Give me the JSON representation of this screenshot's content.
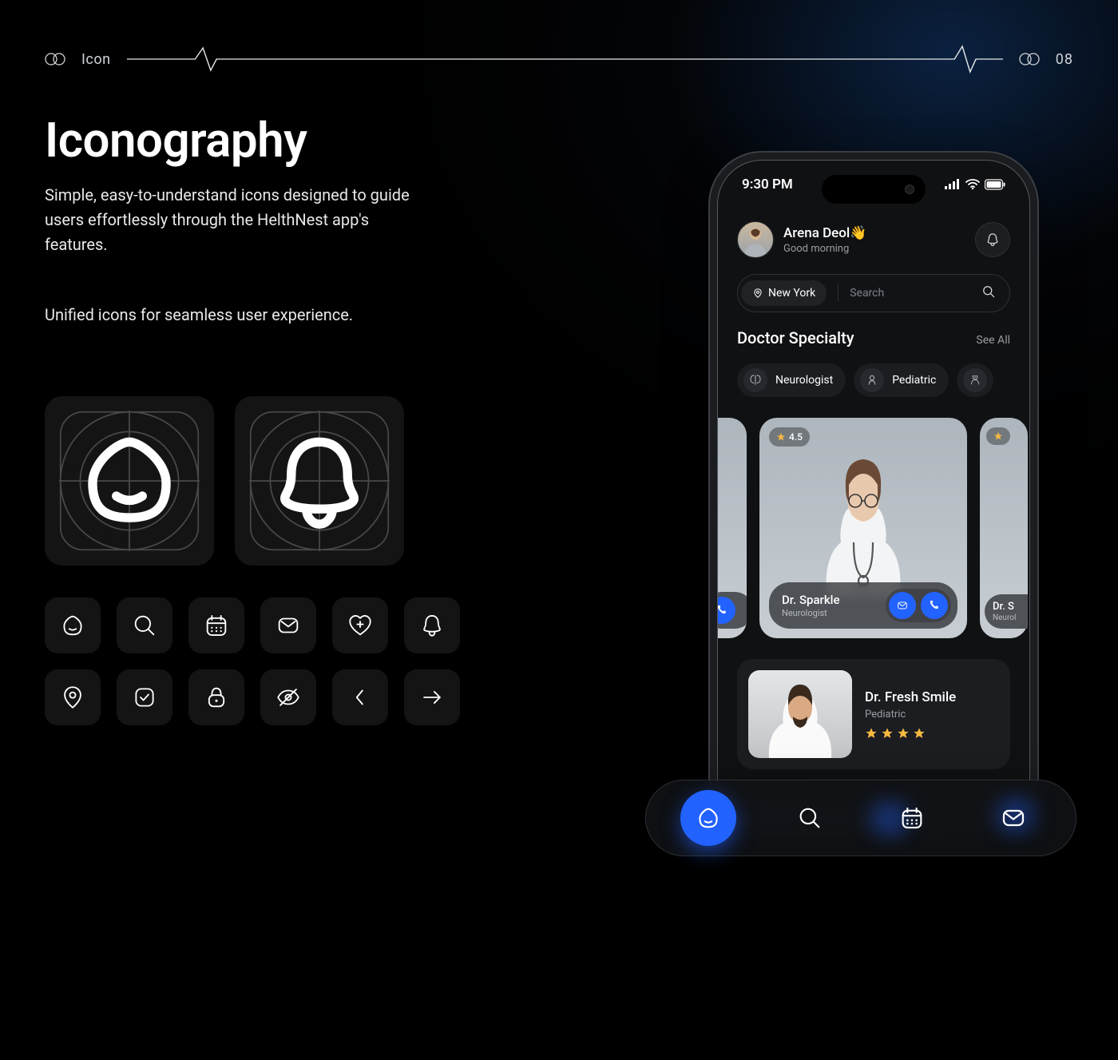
{
  "header": {
    "label": "Icon",
    "page": "08"
  },
  "page": {
    "title": "Iconography",
    "description": "Simple, easy-to-understand icons designed to guide users effortlessly through the HelthNest app's features.",
    "sub": "Unified icons for seamless user experience."
  },
  "icons": {
    "large": [
      "home-icon",
      "bell-icon"
    ],
    "grid": [
      "home-icon",
      "search-icon",
      "calendar-icon",
      "mail-icon",
      "heart-plus-icon",
      "bell-icon",
      "pin-icon",
      "check-square-icon",
      "lock-icon",
      "eye-off-icon",
      "chevron-left-icon",
      "arrow-right-icon"
    ]
  },
  "phone": {
    "status_time": "9:30 PM",
    "user_name": "Arena Deol",
    "user_emoji": "👋",
    "greeting": "Good morning",
    "location": "New York",
    "search_placeholder": "Search",
    "section_title": "Doctor Specialty",
    "see_all": "See All",
    "chips": [
      {
        "icon": "brain-icon",
        "label": "Neurologist"
      },
      {
        "icon": "pediatric-icon",
        "label": "Pediatric"
      },
      {
        "icon": "nurse-icon",
        "label": ""
      }
    ],
    "featured": {
      "rating": "4.5",
      "name": "Dr. Sparkle",
      "specialty": "Neurologist"
    },
    "side_card": {
      "name_prefix": "Dr. S",
      "specialty_prefix": "Neurol"
    },
    "list": {
      "name": "Dr. Fresh Smile",
      "specialty": "Pediatric",
      "stars": 4
    }
  },
  "nav": [
    "home-icon",
    "search-icon",
    "calendar-icon",
    "mail-icon"
  ]
}
